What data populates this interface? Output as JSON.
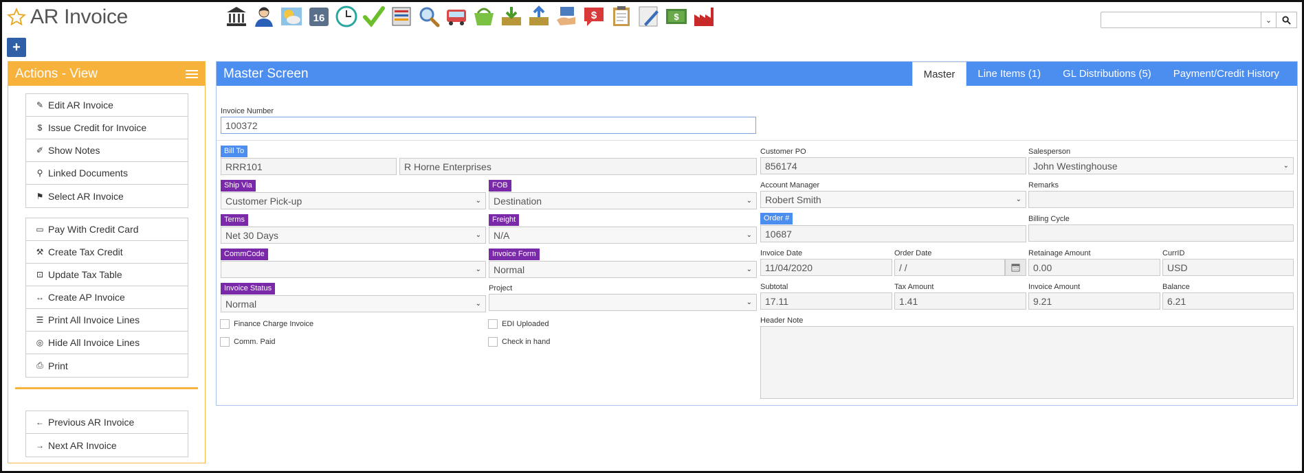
{
  "app": {
    "title": "AR Invoice"
  },
  "toolbar": {
    "icons": [
      "bank-icon",
      "user-icon",
      "weather-icon",
      "calendar-icon",
      "clock-icon",
      "check-icon",
      "report-icon",
      "search-icon",
      "truck-icon",
      "basket-icon",
      "inbox-download-icon",
      "upload-icon",
      "hand-card-icon",
      "chat-dollar-icon",
      "clipboard-icon",
      "pen-icon",
      "money-icon",
      "factory-icon"
    ],
    "calendar_day": "16"
  },
  "search": {
    "placeholder": ""
  },
  "add_button": {
    "label": "+"
  },
  "actions": {
    "title": "Actions - View",
    "group1": [
      {
        "label": "Edit AR Invoice",
        "icon": "✎"
      },
      {
        "label": "Issue Credit for Invoice",
        "icon": "$"
      },
      {
        "label": "Show Notes",
        "icon": "✐"
      },
      {
        "label": "Linked Documents",
        "icon": "⚲"
      },
      {
        "label": "Select AR Invoice",
        "icon": "⚑"
      }
    ],
    "group2": [
      {
        "label": "Pay With Credit Card",
        "icon": "▭"
      },
      {
        "label": "Create Tax Credit",
        "icon": "⚒"
      },
      {
        "label": "Update Tax Table",
        "icon": "⊡"
      },
      {
        "label": "Create AP Invoice",
        "icon": "↔"
      },
      {
        "label": "Print All Invoice Lines",
        "icon": "☰"
      },
      {
        "label": "Hide All Invoice Lines",
        "icon": "◎"
      },
      {
        "label": "Print",
        "icon": "⎙"
      }
    ],
    "group3": [
      {
        "label": "Previous AR Invoice",
        "icon": "←"
      },
      {
        "label": "Next AR Invoice",
        "icon": "→"
      }
    ]
  },
  "master": {
    "title": "Master Screen",
    "tabs": [
      "Master",
      "Line Items (1)",
      "GL Distributions (5)",
      "Payment/Credit History"
    ],
    "invoice_number": {
      "label": "Invoice Number",
      "value": "100372"
    },
    "bill_to": {
      "label": "Bill To",
      "code": "RRR101",
      "name": "R Horne Enterprises"
    },
    "ship_via": {
      "label": "Ship Via",
      "value": "Customer Pick-up"
    },
    "fob": {
      "label": "FOB",
      "value": "Destination"
    },
    "terms": {
      "label": "Terms",
      "value": "Net 30 Days"
    },
    "freight": {
      "label": "Freight",
      "value": "N/A"
    },
    "commcode": {
      "label": "CommCode",
      "value": ""
    },
    "invoice_form": {
      "label": "Invoice Form",
      "value": "Normal"
    },
    "invoice_status": {
      "label": "Invoice Status",
      "value": "Normal"
    },
    "project": {
      "label": "Project",
      "value": ""
    },
    "checkboxes": {
      "finance_charge": "Finance Charge Invoice",
      "edi_uploaded": "EDI Uploaded",
      "comm_paid": "Comm. Paid",
      "check_in_hand": "Check in hand"
    },
    "customer_po": {
      "label": "Customer PO",
      "value": "856174"
    },
    "salesperson": {
      "label": "Salesperson",
      "value": "John Westinghouse"
    },
    "account_manager": {
      "label": "Account Manager",
      "value": "Robert Smith"
    },
    "remarks": {
      "label": "Remarks",
      "value": ""
    },
    "order_no": {
      "label": "Order #",
      "value": "10687"
    },
    "billing_cycle": {
      "label": "Billing Cycle",
      "value": ""
    },
    "invoice_date": {
      "label": "Invoice Date",
      "value": "11/04/2020"
    },
    "order_date": {
      "label": "Order Date",
      "value": " /  /"
    },
    "retainage_amount": {
      "label": "Retainage Amount",
      "value": "0.00"
    },
    "curr_id": {
      "label": "CurrID",
      "value": "USD"
    },
    "subtotal": {
      "label": "Subtotal",
      "value": "17.11"
    },
    "tax_amount": {
      "label": "Tax Amount",
      "value": "1.41"
    },
    "invoice_amount": {
      "label": "Invoice Amount",
      "value": "9.21"
    },
    "balance": {
      "label": "Balance",
      "value": "6.21"
    },
    "header_note": {
      "label": "Header Note",
      "value": ""
    }
  },
  "colors": {
    "accent_blue": "#4b8ef0",
    "orange": "#f7b23b",
    "purple": "#7a2aa8",
    "add_blue": "#2f5fa6"
  }
}
